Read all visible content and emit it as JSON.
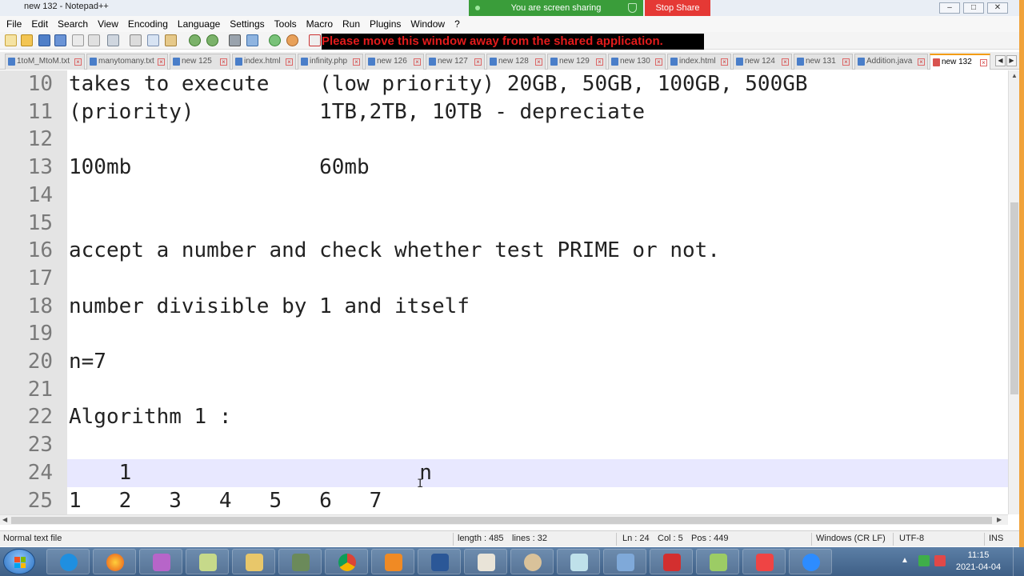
{
  "window": {
    "title": "new 132 - Notepad++",
    "share_banner": "You are screen sharing",
    "stop_share": "Stop Share",
    "warning": "Please move this window away from the shared application."
  },
  "menu": [
    "File",
    "Edit",
    "Search",
    "View",
    "Encoding",
    "Language",
    "Settings",
    "Tools",
    "Macro",
    "Run",
    "Plugins",
    "Window",
    "?"
  ],
  "toolbar_icons": [
    "new-file-icon",
    "open-file-icon",
    "save-icon",
    "save-all-icon",
    "close-icon",
    "close-all-icon",
    "print-icon",
    "cut-icon",
    "copy-icon",
    "paste-icon",
    "undo-icon",
    "redo-icon",
    "find-icon",
    "replace-icon",
    "zoom-in-icon",
    "zoom-out-icon",
    "sync-icon"
  ],
  "tabs": [
    {
      "label": "1toM_MtoM.txt",
      "active": false
    },
    {
      "label": "manytomany.txt",
      "active": false
    },
    {
      "label": "new 125",
      "active": false
    },
    {
      "label": "index.html",
      "active": false
    },
    {
      "label": "infinity.php",
      "active": false
    },
    {
      "label": "new 126",
      "active": false
    },
    {
      "label": "new 127",
      "active": false
    },
    {
      "label": "new 128",
      "active": false
    },
    {
      "label": "new 129",
      "active": false
    },
    {
      "label": "new 130",
      "active": false
    },
    {
      "label": "index.html",
      "active": false
    },
    {
      "label": "new 124",
      "active": false
    },
    {
      "label": "new 131",
      "active": false
    },
    {
      "label": "Addition.java",
      "active": false
    },
    {
      "label": "new 132",
      "active": true
    }
  ],
  "editor": {
    "lines": [
      {
        "num": "10",
        "text": "takes to execute    (low priority) 20GB, 50GB, 100GB, 500GB"
      },
      {
        "num": "11",
        "text": "(priority)          1TB,2TB, 10TB - depreciate"
      },
      {
        "num": "12",
        "text": ""
      },
      {
        "num": "13",
        "text": "100mb               60mb"
      },
      {
        "num": "14",
        "text": ""
      },
      {
        "num": "15",
        "text": ""
      },
      {
        "num": "16",
        "text": "accept a number and check whether test PRIME or not."
      },
      {
        "num": "17",
        "text": ""
      },
      {
        "num": "18",
        "text": "number divisible by 1 and itself"
      },
      {
        "num": "19",
        "text": ""
      },
      {
        "num": "20",
        "text": "n=7"
      },
      {
        "num": "21",
        "text": ""
      },
      {
        "num": "22",
        "text": "Algorithm 1 :"
      },
      {
        "num": "23",
        "text": ""
      },
      {
        "num": "24",
        "text": "    1                       n"
      },
      {
        "num": "25",
        "text": "1   2   3   4   5   6   7"
      }
    ],
    "current_line": "24"
  },
  "status": {
    "file_type": "Normal text file",
    "length": "length : 485",
    "lines": "lines : 32",
    "ln": "Ln : 24",
    "col": "Col : 5",
    "pos": "Pos : 449",
    "eol": "Windows (CR LF)",
    "encoding": "UTF-8",
    "mode": "INS"
  },
  "taskbar": {
    "apps": [
      "internet-explorer-icon",
      "firefox-icon",
      "visual-studio-icon",
      "notes-icon",
      "file-explorer-icon",
      "app-installer-icon",
      "chrome-icon",
      "media-player-icon",
      "word-icon",
      "java-icon",
      "paint-icon",
      "screen-tool-icon",
      "remote-desktop-icon",
      "acrobat-icon",
      "notepad-plus-plus-icon",
      "anydesk-icon",
      "zoom-icon"
    ],
    "time": "11:15",
    "date": "2021-04-04"
  }
}
